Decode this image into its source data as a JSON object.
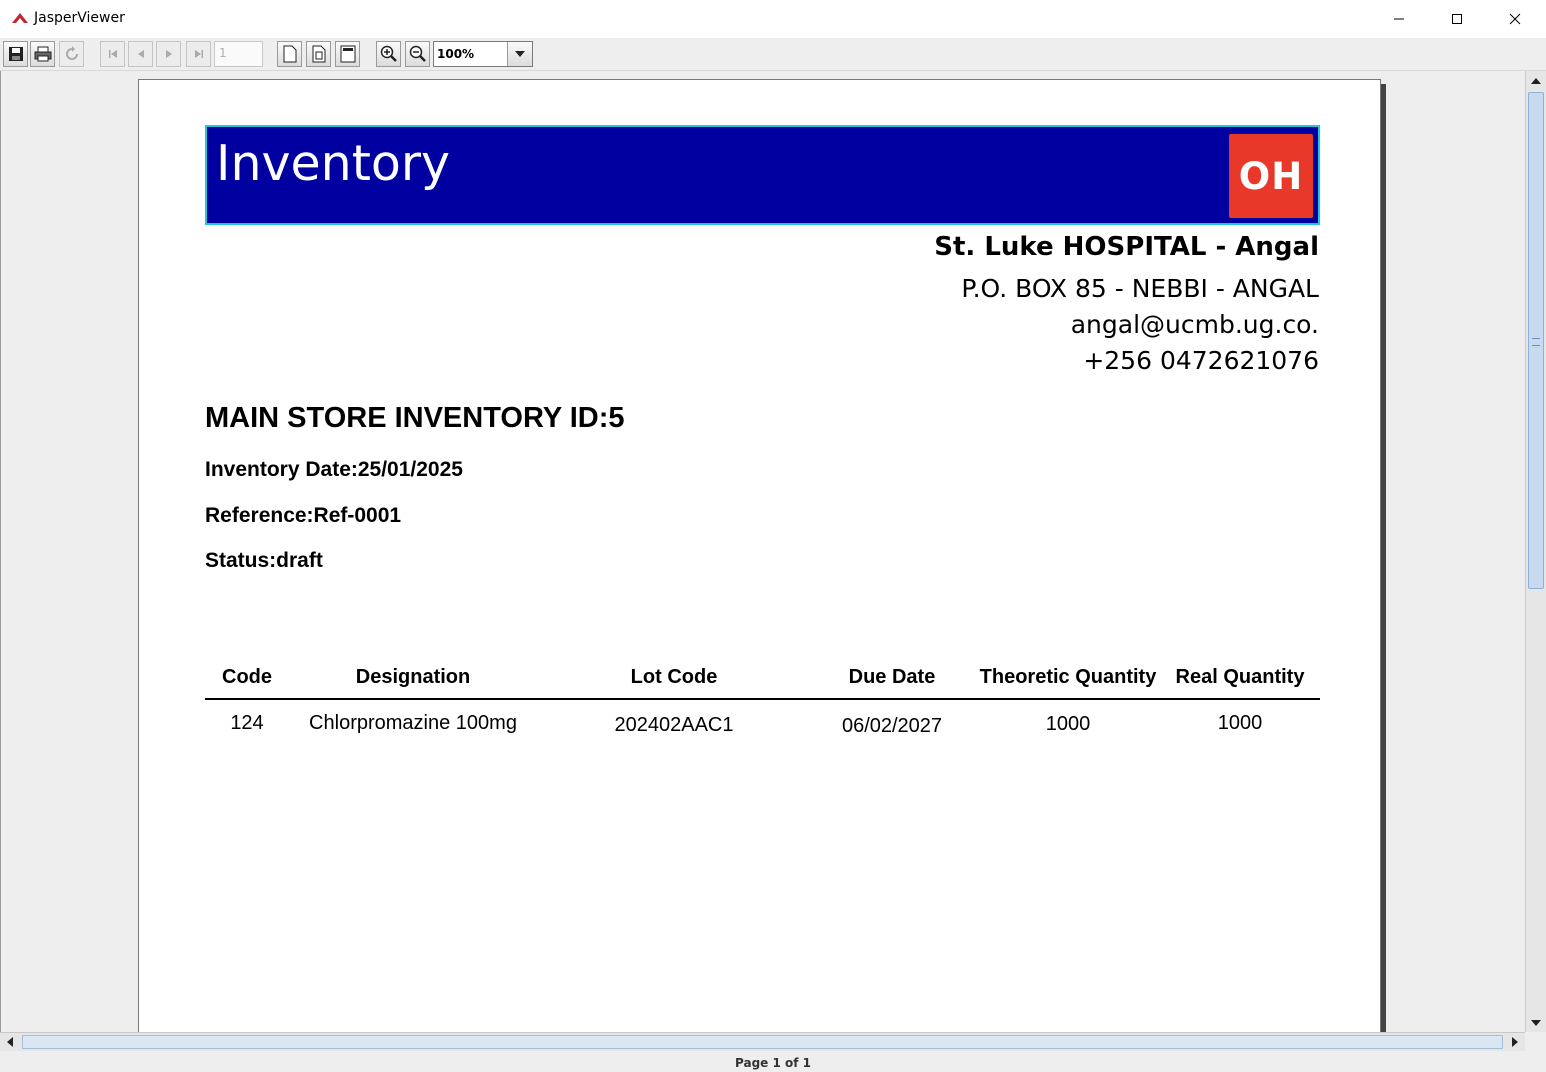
{
  "window": {
    "title": "JasperViewer"
  },
  "toolbar": {
    "page_number": "1",
    "zoom": "100%",
    "buttons": [
      "save-icon",
      "print-icon",
      "reload-icon",
      "first-page-icon",
      "previous-page-icon",
      "next-page-icon",
      "last-page-icon",
      "actual-size-icon",
      "fit-page-icon",
      "fit-width-icon",
      "zoom-in-icon",
      "zoom-out-icon"
    ]
  },
  "report": {
    "banner_title": "Inventory",
    "logo_text": "OH",
    "colors": {
      "banner": "#0000a0",
      "banner_border": "#1ec8e0",
      "logo": "#e8382a"
    },
    "hospital": {
      "name": "St. Luke HOSPITAL - Angal",
      "address": "P.O. BOX 85 - NEBBI - ANGAL",
      "email": "angal@ucmb.ug.co.",
      "phone": "+256 0472621076"
    },
    "title": "MAIN STORE INVENTORY ID:5",
    "inventory_date": "Inventory Date:25/01/2025",
    "reference": "Reference:Ref-0001",
    "status": "Status:draft",
    "table": {
      "headers": [
        "Code",
        "Designation",
        "Lot Code",
        "Due Date",
        "Theoretic Quantity",
        "Real Quantity"
      ],
      "rows": [
        [
          "124",
          "Chlorpromazine 100mg",
          "202402AAC1",
          "06/02/2027",
          "1000",
          "1000"
        ]
      ]
    }
  },
  "status_bar": {
    "page_status": "Page 1 of 1"
  }
}
